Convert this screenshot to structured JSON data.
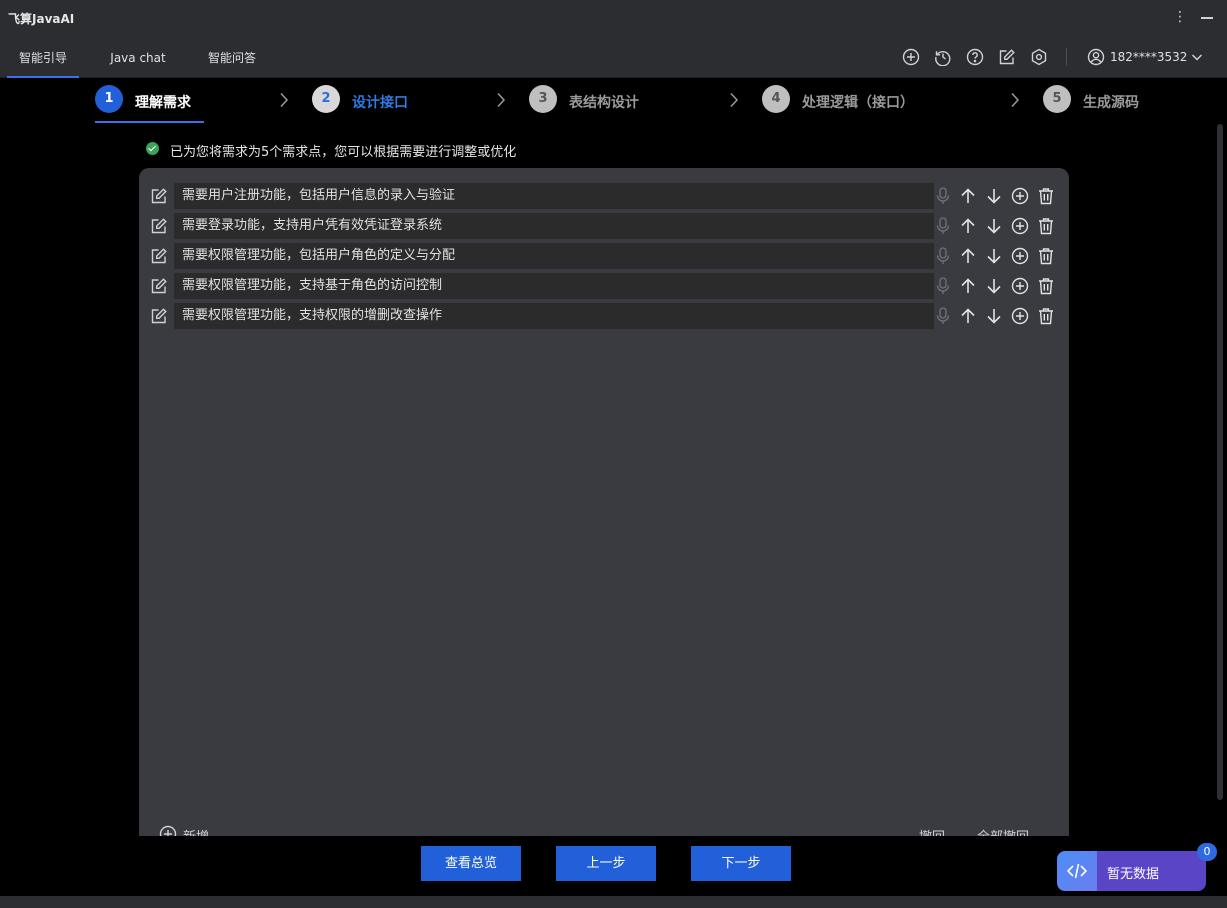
{
  "window": {
    "title": "飞算JavaAI"
  },
  "tabs": [
    {
      "label": "智能引导",
      "active": true
    },
    {
      "label": "Java chat",
      "active": false
    },
    {
      "label": "智能问答",
      "active": false
    }
  ],
  "toolbar_icons": [
    "plus-circle-icon",
    "history-icon",
    "help-icon",
    "edit-icon",
    "settings-icon"
  ],
  "user": {
    "phone": "182****3532"
  },
  "steps": [
    {
      "num": "1",
      "label": "理解需求",
      "state": "done"
    },
    {
      "num": "2",
      "label": "设计接口",
      "state": "current"
    },
    {
      "num": "3",
      "label": "表结构设计",
      "state": "todo"
    },
    {
      "num": "4",
      "label": "处理逻辑（接口）",
      "state": "todo"
    },
    {
      "num": "5",
      "label": "生成源码",
      "state": "todo"
    }
  ],
  "notice": "已为您将需求为5个需求点，您可以根据需要进行调整或优化",
  "requirements": [
    "需要用户注册功能，包括用户信息的录入与验证",
    "需要登录功能，支持用户凭有效凭证登录系统",
    "需要权限管理功能，包括用户角色的定义与分配",
    "需要权限管理功能，支持基于角色的访问控制",
    "需要权限管理功能，支持权限的增删改查操作"
  ],
  "panel_footer": {
    "add": "新增",
    "undo": "撤回",
    "undo_all": "全部撤回"
  },
  "buttons": {
    "overview": "查看总览",
    "prev": "上一步",
    "next": "下一步"
  },
  "widget": {
    "text": "暂无数据",
    "badge": "0"
  },
  "colors": {
    "accent": "#2260d9",
    "step_current": "#2d7be5",
    "success": "#3da35a",
    "widget": "#5a45c7"
  }
}
